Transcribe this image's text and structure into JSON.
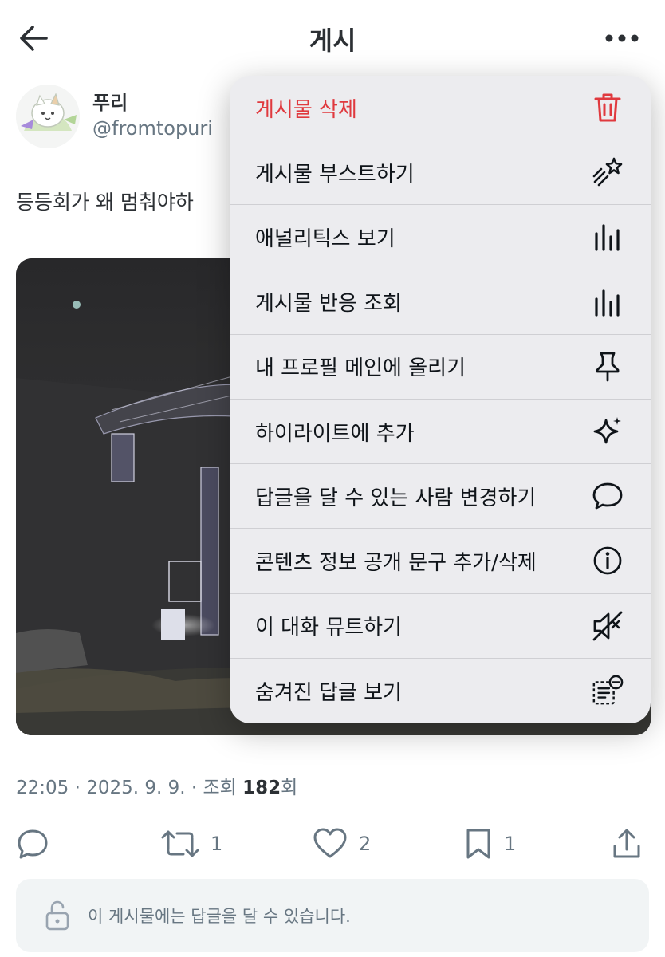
{
  "header": {
    "title": "게시"
  },
  "author": {
    "display_name": "푸리",
    "handle": "@fromtopuri"
  },
  "post": {
    "text": "등등회가 왜 멈춰야하",
    "timestamp": "22:05 · 2025. 9. 9. · 조회 ",
    "views": "182",
    "views_suffix": "회"
  },
  "actions": {
    "retweets": "1",
    "likes": "2",
    "bookmarks": "1"
  },
  "reply_box": {
    "text": "이 게시물에는 답글을 달 수 있습니다."
  },
  "menu": {
    "items": [
      {
        "label": "게시물 삭제",
        "icon": "trash-icon"
      },
      {
        "label": "게시물 부스트하기",
        "icon": "boost-icon"
      },
      {
        "label": "애널리틱스 보기",
        "icon": "analytics-icon"
      },
      {
        "label": "게시물 반응 조회",
        "icon": "analytics-icon"
      },
      {
        "label": "내 프로필 메인에 올리기",
        "icon": "pin-icon"
      },
      {
        "label": "하이라이트에 추가",
        "icon": "sparkle-icon"
      },
      {
        "label": "답글을 달 수 있는 사람 변경하기",
        "icon": "speech-bubble-icon"
      },
      {
        "label": "콘텐츠 정보 공개 문구 추가/삭제",
        "icon": "info-icon"
      },
      {
        "label": "이 대화 뮤트하기",
        "icon": "mute-icon"
      },
      {
        "label": "숨겨진 답글 보기",
        "icon": "hidden-replies-icon"
      }
    ]
  },
  "colors": {
    "danger": "#e0393e",
    "secondary_text": "#536471",
    "menu_bg": "#ececef"
  }
}
